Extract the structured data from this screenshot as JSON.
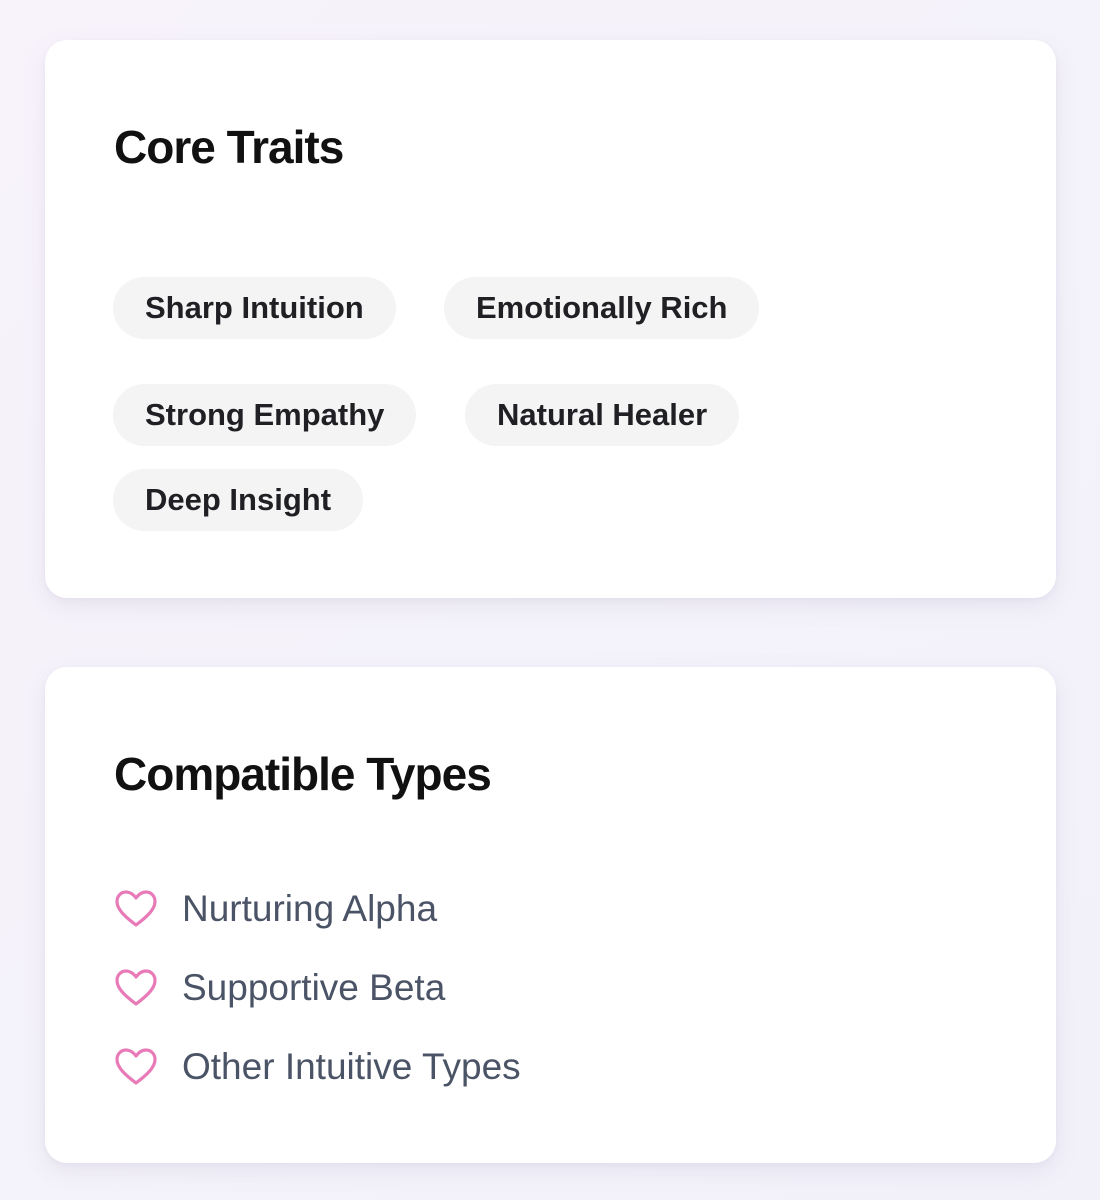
{
  "core_traits": {
    "title": "Core Traits",
    "chips": [
      "Sharp Intuition",
      "Emotionally Rich",
      "Strong Empathy",
      "Natural Healer",
      "Deep Insight"
    ]
  },
  "compatible_types": {
    "title": "Compatible Types",
    "items": [
      "Nurturing Alpha",
      "Supportive Beta",
      "Other Intuitive Types"
    ],
    "icon": "heart-outline-icon",
    "icon_color": "#e87ab8"
  }
}
